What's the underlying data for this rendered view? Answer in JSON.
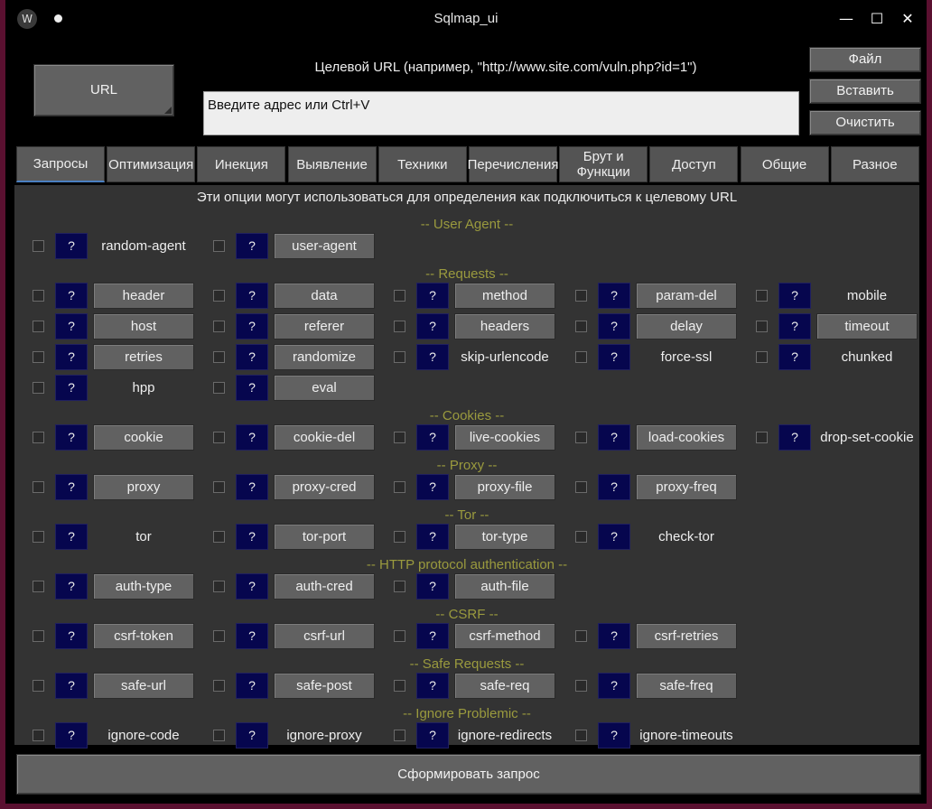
{
  "window": {
    "title": "Sqlmap_ui",
    "minimize_glyph": "—",
    "maximize_glyph": "☐",
    "close_glyph": "✕",
    "app_icon_glyph": "W"
  },
  "target": {
    "url_button": "URL",
    "label": "Целевой URL (например, \"http://www.site.com/vuln.php?id=1\")",
    "input_value": "Введите адрес или Ctrl+V"
  },
  "side_buttons": [
    "Файл",
    "Вставить",
    "Очистить"
  ],
  "tabs": [
    "Запросы",
    "Оптимизация",
    "Инекция",
    "Выявление",
    "Техники",
    "Перечисления",
    "Брут и Функции",
    "Доступ",
    "Общие",
    "Разное"
  ],
  "active_tab": "Запросы",
  "panel": {
    "description": "Эти опции могут использоваться для определения как подключиться к целевому URL",
    "help_label": "?",
    "sections": [
      {
        "title": "-- User Agent --",
        "rows": [
          [
            {
              "label": "random-agent",
              "button": false
            },
            {
              "label": "user-agent",
              "button": true
            }
          ]
        ]
      },
      {
        "title": "-- Requests --",
        "rows": [
          [
            {
              "label": "header",
              "button": true
            },
            {
              "label": "data",
              "button": true
            },
            {
              "label": "method",
              "button": true
            },
            {
              "label": "param-del",
              "button": true
            },
            {
              "label": "mobile",
              "button": false
            }
          ],
          [
            {
              "label": "host",
              "button": true
            },
            {
              "label": "referer",
              "button": true
            },
            {
              "label": "headers",
              "button": true
            },
            {
              "label": "delay",
              "button": true
            },
            {
              "label": "timeout",
              "button": true
            }
          ],
          [
            {
              "label": "retries",
              "button": true
            },
            {
              "label": "randomize",
              "button": true
            },
            {
              "label": "skip-urlencode",
              "button": false
            },
            {
              "label": "force-ssl",
              "button": false
            },
            {
              "label": "chunked",
              "button": false
            }
          ],
          [
            {
              "label": "hpp",
              "button": false
            },
            {
              "label": "eval",
              "button": true
            }
          ]
        ]
      },
      {
        "title": "-- Cookies --",
        "rows": [
          [
            {
              "label": "cookie",
              "button": true
            },
            {
              "label": "cookie-del",
              "button": true
            },
            {
              "label": "live-cookies",
              "button": true
            },
            {
              "label": "load-cookies",
              "button": true
            },
            {
              "label": "drop-set-cookie",
              "button": false
            }
          ]
        ]
      },
      {
        "title": "-- Proxy --",
        "rows": [
          [
            {
              "label": "proxy",
              "button": true
            },
            {
              "label": "proxy-cred",
              "button": true
            },
            {
              "label": "proxy-file",
              "button": true
            },
            {
              "label": "proxy-freq",
              "button": true
            }
          ]
        ]
      },
      {
        "title": "-- Tor --",
        "rows": [
          [
            {
              "label": "tor",
              "button": false
            },
            {
              "label": "tor-port",
              "button": true
            },
            {
              "label": "tor-type",
              "button": true
            },
            {
              "label": "check-tor",
              "button": false
            }
          ]
        ]
      },
      {
        "title": "-- HTTP protocol authentication --",
        "rows": [
          [
            {
              "label": "auth-type",
              "button": true
            },
            {
              "label": "auth-cred",
              "button": true
            },
            {
              "label": "auth-file",
              "button": true
            }
          ]
        ]
      },
      {
        "title": "-- CSRF --",
        "rows": [
          [
            {
              "label": "csrf-token",
              "button": true
            },
            {
              "label": "csrf-url",
              "button": true
            },
            {
              "label": "csrf-method",
              "button": true
            },
            {
              "label": "csrf-retries",
              "button": true
            }
          ]
        ]
      },
      {
        "title": "-- Safe Requests --",
        "rows": [
          [
            {
              "label": "safe-url",
              "button": true
            },
            {
              "label": "safe-post",
              "button": true
            },
            {
              "label": "safe-req",
              "button": true
            },
            {
              "label": "safe-freq",
              "button": true
            }
          ]
        ]
      },
      {
        "title": "-- Ignore Problemic --",
        "rows": [
          [
            {
              "label": "ignore-code",
              "button": false
            },
            {
              "label": "ignore-proxy",
              "button": false
            },
            {
              "label": "ignore-redirects",
              "button": false
            },
            {
              "label": "ignore-timeouts",
              "button": false
            }
          ]
        ]
      }
    ]
  },
  "submit_label": "Сформировать запрос"
}
